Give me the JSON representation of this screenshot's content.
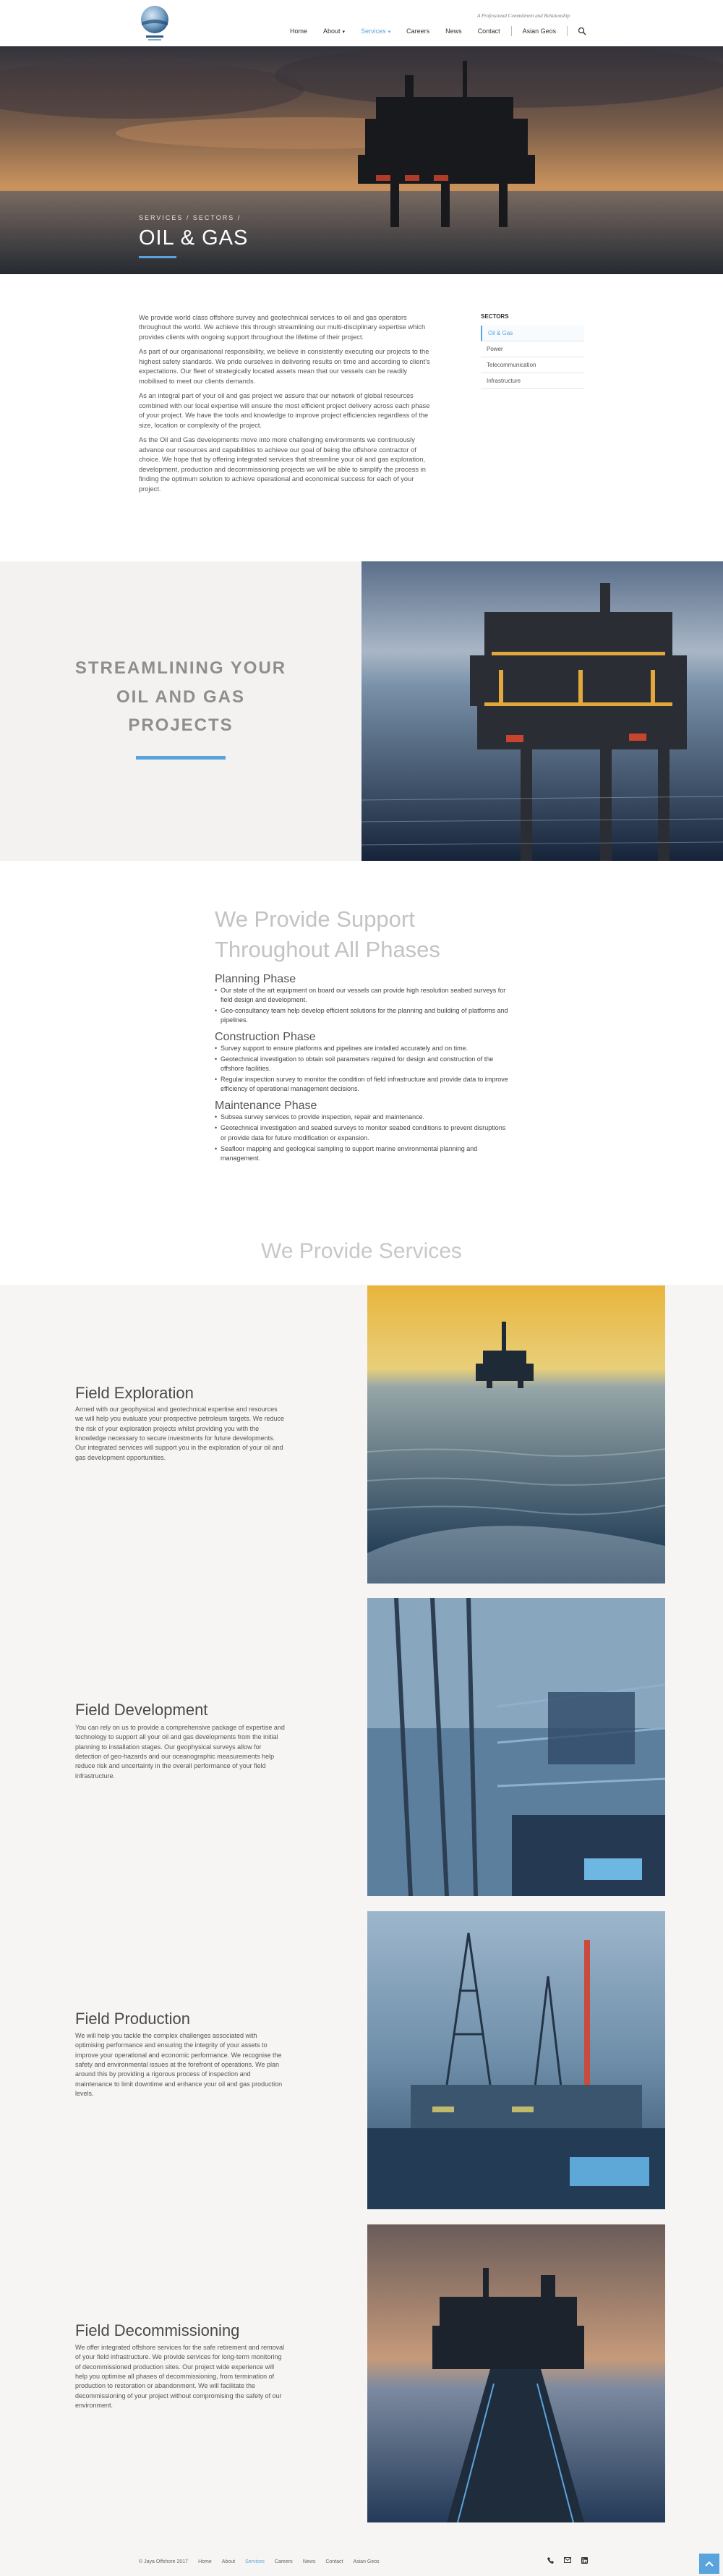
{
  "header": {
    "tagline": "A Professional Commitment and Relationship",
    "nav": [
      {
        "label": "Home"
      },
      {
        "label": "About"
      },
      {
        "label": "Services"
      },
      {
        "label": "Careers"
      },
      {
        "label": "News"
      },
      {
        "label": "Contact"
      },
      {
        "label": "Asian Geos"
      }
    ]
  },
  "hero": {
    "breadcrumb": "SERVICES / SECTORS /",
    "title": "OIL & GAS"
  },
  "intro": {
    "paragraphs": [
      "We provide world class offshore survey and geotechnical services to oil and gas operators throughout the world. We achieve this through streamlining our multi-disciplinary expertise which provides clients with ongoing support throughout the lifetime of their project.",
      "As part of our organisational responsibility, we believe in consistently executing our projects to the highest safety standards. We pride ourselves in delivering results on time and according to client's expectations. Our fleet of strategically located assets mean that our vessels can be readily mobilised to meet our clients demands.",
      "As an integral part of your oil and gas project we assure that our network of global resources combined with our local expertise will ensure the most efficient project delivery across each phase of your project. We have the tools and knowledge to improve project efficiencies regardless of the size, location or complexity of the project.",
      "As the Oil and Gas developments move into more challenging environments we continuously advance our resources and capabilities to achieve our goal of being the offshore contractor of choice. We hope that by offering integrated services that streamline your oil and gas exploration, development, production and decommissioning projects we will be able to simplify the process in finding the optimum solution to achieve operational and economical success for each of your project."
    ]
  },
  "sectors": {
    "title": "SECTORS",
    "items": [
      {
        "label": "Oil & Gas"
      },
      {
        "label": "Power"
      },
      {
        "label": "Telecommunication"
      },
      {
        "label": "Infrastructure"
      }
    ]
  },
  "streamline": {
    "title": "STREAMLINING YOUR OIL AND GAS PROJECTS"
  },
  "support": {
    "title": "We Provide Support Throughout All Phases",
    "phases": [
      {
        "title": "Planning Phase",
        "items": [
          "Our state of the art equipment on board our vessels can provide high resolution seabed surveys for field design and development.",
          "Geo-consultancy team help develop efficient solutions for the planning and building of platforms and pipelines."
        ]
      },
      {
        "title": "Construction Phase",
        "items": [
          "Survey support to ensure platforms and pipelines are installed accurately and on time.",
          "Geotechnical investigation to obtain soil parameters required for design and construction of the offshore facilities.",
          "Regular inspection survey to monitor the condition of field infrastructure and provide data to improve efficiency of operational management decisions."
        ]
      },
      {
        "title": "Maintenance Phase",
        "items": [
          "Subsea survey services to provide inspection, repair and maintenance.",
          "Geotechnical investigation and seabed surveys to monitor seabed conditions to prevent disruptions or provide data for future modification or expansion.",
          "Seafloor mapping and geological sampling to support marine environmental planning and management."
        ]
      }
    ]
  },
  "services": {
    "title": "We Provide Services",
    "items": [
      {
        "title": "Field Exploration",
        "text": "Armed with our geophysical and geotechnical expertise and resources we will help you evaluate your prospective petroleum targets. We reduce the risk of your exploration projects whilst providing you with the knowledge necessary to secure investments for future developments. Our integrated services will support you in the exploration of your oil and gas development opportunities."
      },
      {
        "title": "Field Development",
        "text": "You can rely on us to provide a comprehensive package of expertise and technology to support all your oil and gas developments from the initial planning to installation stages. Our geophysical surveys allow for detection of geo-hazards and our oceanographic measurements help reduce risk and uncertainty in the overall performance of your field infrastructure."
      },
      {
        "title": "Field Production",
        "text": "We will help you tackle the complex challenges associated with optimising performance and ensuring the integrity of your assets to improve your operational and economic performance. We recognise the safety and environmental issues at the forefront of operations. We plan around this by providing a rigorous process of inspection and maintenance to limit downtime and enhance your oil and gas production levels."
      },
      {
        "title": "Field Decommissioning",
        "text": "We offer integrated offshore services for the safe retirement and removal of your field infrastructure. We provide services for long-term monitoring of decommissioned production sites. Our project wide experience will help you optimise all phases of decommissioning, from termination of production to restoration or abandonment. We will facilitate the decommissioning of your project without compromising the safety of our environment."
      }
    ]
  },
  "footer": {
    "copyright": "© Jaya Offshore 2017",
    "links": [
      {
        "label": "Home"
      },
      {
        "label": "About"
      },
      {
        "label": "Services"
      },
      {
        "label": "Careers"
      },
      {
        "label": "News"
      },
      {
        "label": "Contact"
      },
      {
        "label": "Asian Geos"
      }
    ]
  },
  "colors": {
    "accent": "#5aa4de",
    "panel": "#f6f5f4"
  }
}
